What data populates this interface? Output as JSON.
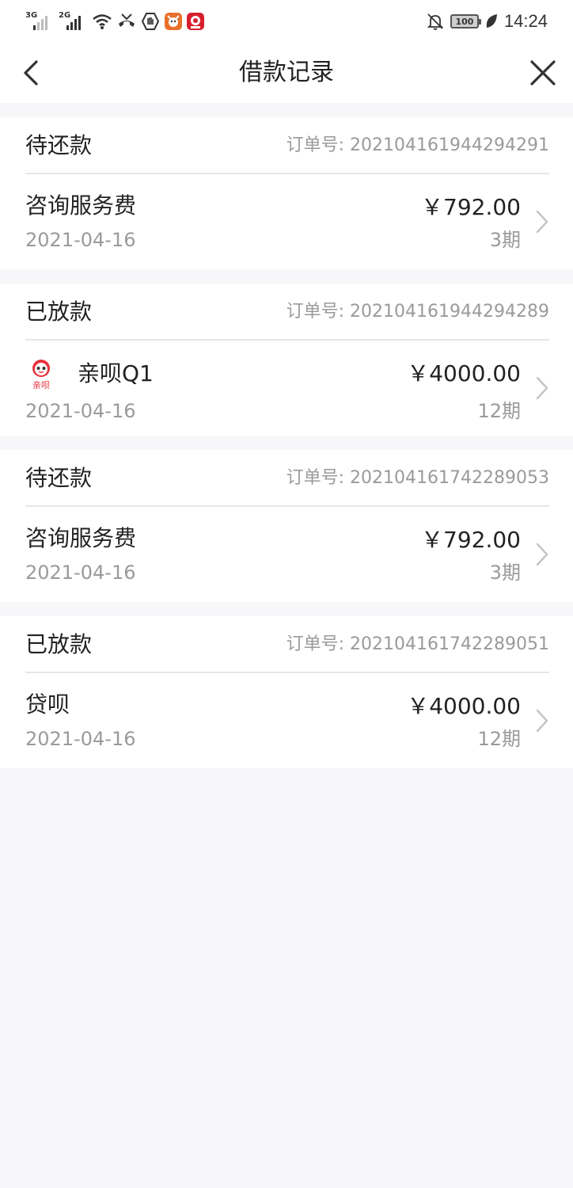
{
  "status_bar": {
    "network1": "3G",
    "network2": "2G",
    "battery": "100",
    "time": "14:24"
  },
  "header": {
    "title": "借款记录"
  },
  "records": [
    {
      "status": "待还款",
      "order_label": "订单号: 202104161944294291",
      "item_name": "咨询服务费",
      "date": "2021-04-16",
      "amount": "￥792.00",
      "period": "3期",
      "has_logo": false
    },
    {
      "status": "已放款",
      "order_label": "订单号: 202104161944294289",
      "item_name": "亲呗Q1",
      "date": "2021-04-16",
      "amount": "￥4000.00",
      "period": "12期",
      "has_logo": true,
      "logo_text": "亲呗"
    },
    {
      "status": "待还款",
      "order_label": "订单号: 202104161742289053",
      "item_name": "咨询服务费",
      "date": "2021-04-16",
      "amount": "￥792.00",
      "period": "3期",
      "has_logo": false
    },
    {
      "status": "已放款",
      "order_label": "订单号: 202104161742289051",
      "item_name": "贷呗",
      "date": "2021-04-16",
      "amount": "￥4000.00",
      "period": "12期",
      "has_logo": false
    }
  ],
  "colors": {
    "background": "#f7f6f9",
    "card": "#ffffff",
    "text_primary": "#222222",
    "text_secondary": "#9a9a9a",
    "brand_red": "#e8323c"
  }
}
